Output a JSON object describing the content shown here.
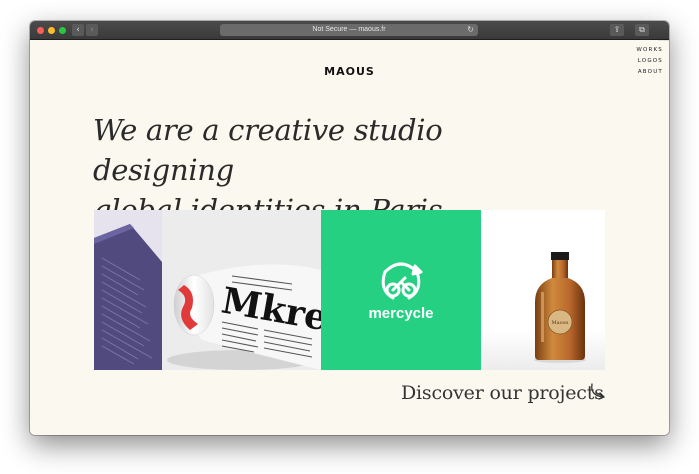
{
  "browser": {
    "url_text": "Not Secure — maous.fr",
    "back_icon": "‹",
    "forward_icon": "›",
    "reload_icon": "↻",
    "share_icon": "⇪",
    "tabs_icon": "⧉",
    "new_tab_icon": "+"
  },
  "site": {
    "logo": "MAOUS",
    "menu": [
      "WORKS",
      "LOGOS",
      "ABOUT"
    ],
    "headline_line1": "We are a creative studio designing",
    "headline_line2": "global identities in Paris.",
    "cta": "Discover our projects",
    "tiles": {
      "mercycle_label": "mercycle",
      "newspaper_headline": "Mkreap",
      "bottle_label": "Maous"
    },
    "colors": {
      "background": "#fbf8ef",
      "mercycle_green": "#25d083",
      "purple_book": "#514a7e",
      "bottle_amber": "#b8672a"
    }
  }
}
